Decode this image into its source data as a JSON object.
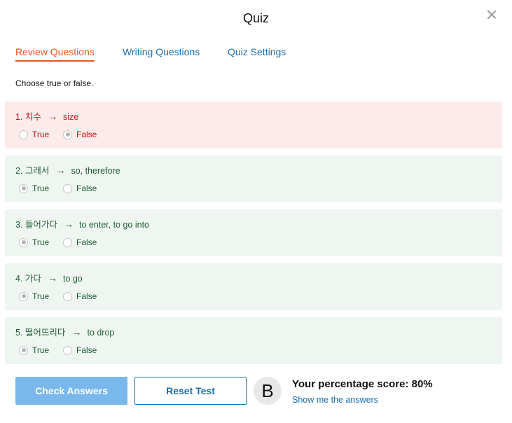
{
  "header": {
    "title": "Quiz"
  },
  "tabs": [
    {
      "label": "Review Questions",
      "active": true
    },
    {
      "label": "Writing Questions",
      "active": false
    },
    {
      "label": "Quiz Settings",
      "active": false
    }
  ],
  "instruction": "Choose true or false.",
  "arrow": "→",
  "questions": [
    {
      "number": "1.",
      "korean": "치수",
      "english": "size",
      "options": [
        "True",
        "False"
      ],
      "selected": "False",
      "result": "wrong"
    },
    {
      "number": "2.",
      "korean": "그래서",
      "english": "so, therefore",
      "options": [
        "True",
        "False"
      ],
      "selected": "True",
      "result": "correct"
    },
    {
      "number": "3.",
      "korean": "들어가다",
      "english": "to enter, to go into",
      "options": [
        "True",
        "False"
      ],
      "selected": "True",
      "result": "correct"
    },
    {
      "number": "4.",
      "korean": "가다",
      "english": "to go",
      "options": [
        "True",
        "False"
      ],
      "selected": "True",
      "result": "correct"
    },
    {
      "number": "5.",
      "korean": "떨어뜨리다",
      "english": "to drop",
      "options": [
        "True",
        "False"
      ],
      "selected": "True",
      "result": "correct"
    }
  ],
  "footer": {
    "check_label": "Check Answers",
    "reset_label": "Reset Test",
    "grade": "B",
    "score_text": "Your percentage score: 80%",
    "show_answers_label": "Show me the answers"
  },
  "colors": {
    "accent_tab": "#e8541f",
    "link": "#1a6fb0",
    "correct_bg": "#eff6f1",
    "correct_text": "#1f5f37",
    "wrong_bg": "#fdeaea",
    "wrong_text": "#c3151c",
    "check_button": "#7ab8ec"
  }
}
